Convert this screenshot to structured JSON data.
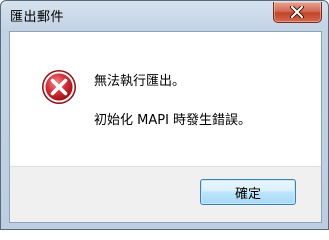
{
  "window": {
    "title": "匯出郵件"
  },
  "dialog": {
    "icon": "error-icon",
    "message_primary": "無法執行匯出。",
    "message_secondary": "初始化 MAPI 時發生錯誤。",
    "ok_label": "確定"
  },
  "colors": {
    "close_button": "#c2432b",
    "error_icon": "#c8202a",
    "ok_button_border": "#3c7fb1"
  }
}
